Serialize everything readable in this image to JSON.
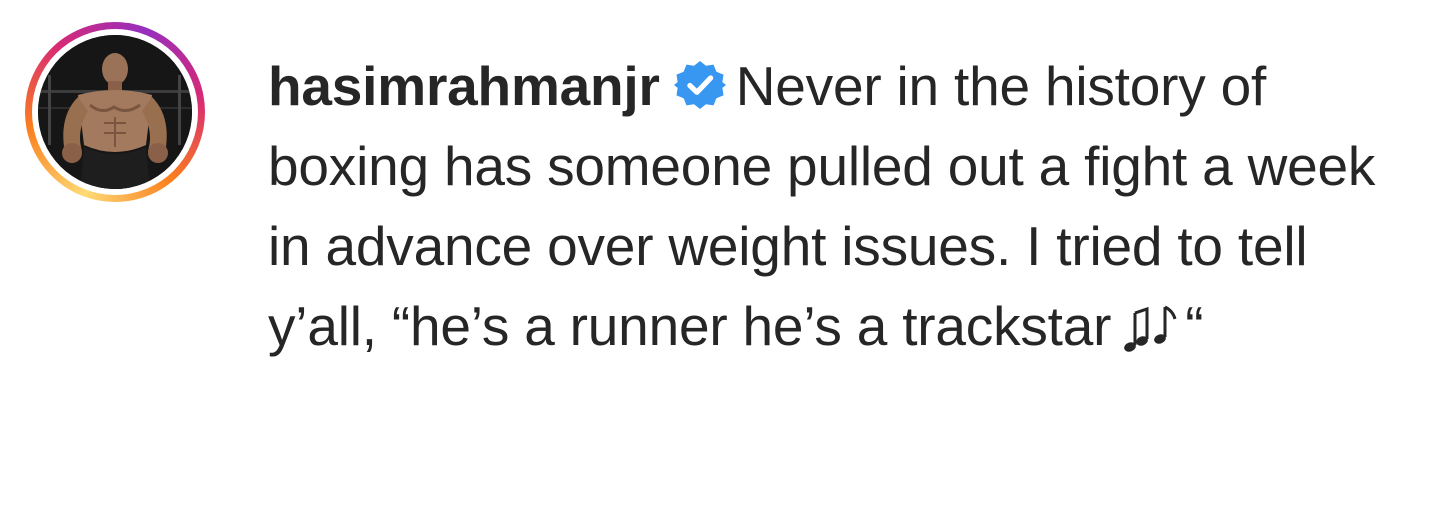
{
  "post": {
    "username": "hasimrahmanjr",
    "verified_icon": "verified-badge-icon",
    "caption_text": "Never in the history of boxing has someone pulled out a fight a week in advance over weight issues. I tried to tell y’all, “he’s a runner he’s a trackstar",
    "music_icon": "music-notes-icon",
    "closing_quote": "“",
    "accent_color": "#3897f0",
    "story_ring_colors": [
      "#feda75",
      "#fa7e1e",
      "#d62976",
      "#962fbf"
    ]
  }
}
